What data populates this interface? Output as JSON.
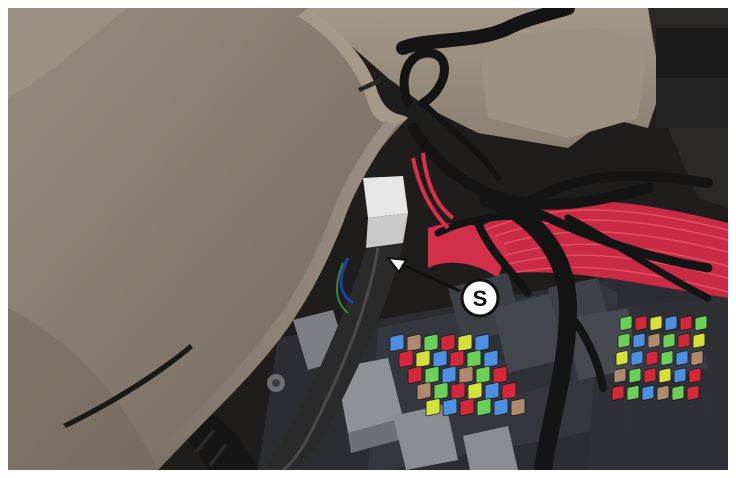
{
  "figure": {
    "callout_label": "S"
  },
  "colors": {
    "trim_panel": "#8a7f72",
    "cavity_dark": "#1c1b19",
    "wire_red": "#d8304a",
    "loom_black": "#151515",
    "relay_grey": "#8d8f93",
    "relay_dark": "#3e4047",
    "fuse_green": "#6ccf58",
    "fuse_blue": "#4d8fe0",
    "fuse_red": "#d3273a",
    "fuse_yellow": "#d6e03a",
    "fuse_tan": "#b08a6e",
    "callout_fill": "#ffffff"
  },
  "icons": [
    "callout-arrow-icon"
  ]
}
